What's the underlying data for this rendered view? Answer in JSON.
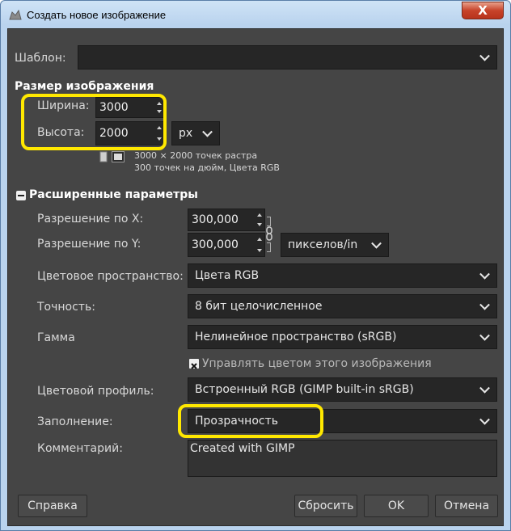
{
  "window": {
    "title": "Создать новое изображение",
    "close_label": "X"
  },
  "template": {
    "label": "Шаблон:",
    "value": ""
  },
  "image_size": {
    "heading": "Размер изображения",
    "width_label": "Ширина:",
    "width_value": "3000",
    "height_label": "Высота:",
    "height_value": "2000",
    "unit": "px",
    "info_line1": "3000 × 2000 точек растра",
    "info_line2": "300 точек на дюйм, Цвета RGB"
  },
  "advanced": {
    "heading": "Расширенные параметры",
    "xres_label": "Разрешение по X:",
    "xres_value": "300,000",
    "yres_label": "Разрешение по Y:",
    "yres_value": "300,000",
    "res_unit": "пикселов/in",
    "colorspace_label": "Цветовое пространство:",
    "colorspace_value": "Цвета RGB",
    "precision_label": "Точность:",
    "precision_value": "8 бит целочисленное",
    "gamma_label": "Гамма",
    "gamma_value": "Нелинейное пространство (sRGB)",
    "manage_color_label": "Управлять цветом этого изображения",
    "manage_color_checked": true,
    "profile_label": "Цветовой профиль:",
    "profile_value": "Встроенный RGB (GIMP built-in sRGB)",
    "fill_label": "Заполнение:",
    "fill_value": "Прозрачность",
    "comment_label": "Комментарий:",
    "comment_value": "Created with GIMP"
  },
  "buttons": {
    "help": "Справка",
    "reset": "Сбросить",
    "ok": "OK",
    "cancel": "Отмена"
  },
  "colors": {
    "highlight": "#ffe800",
    "panel": "#454545",
    "field": "#262626"
  }
}
